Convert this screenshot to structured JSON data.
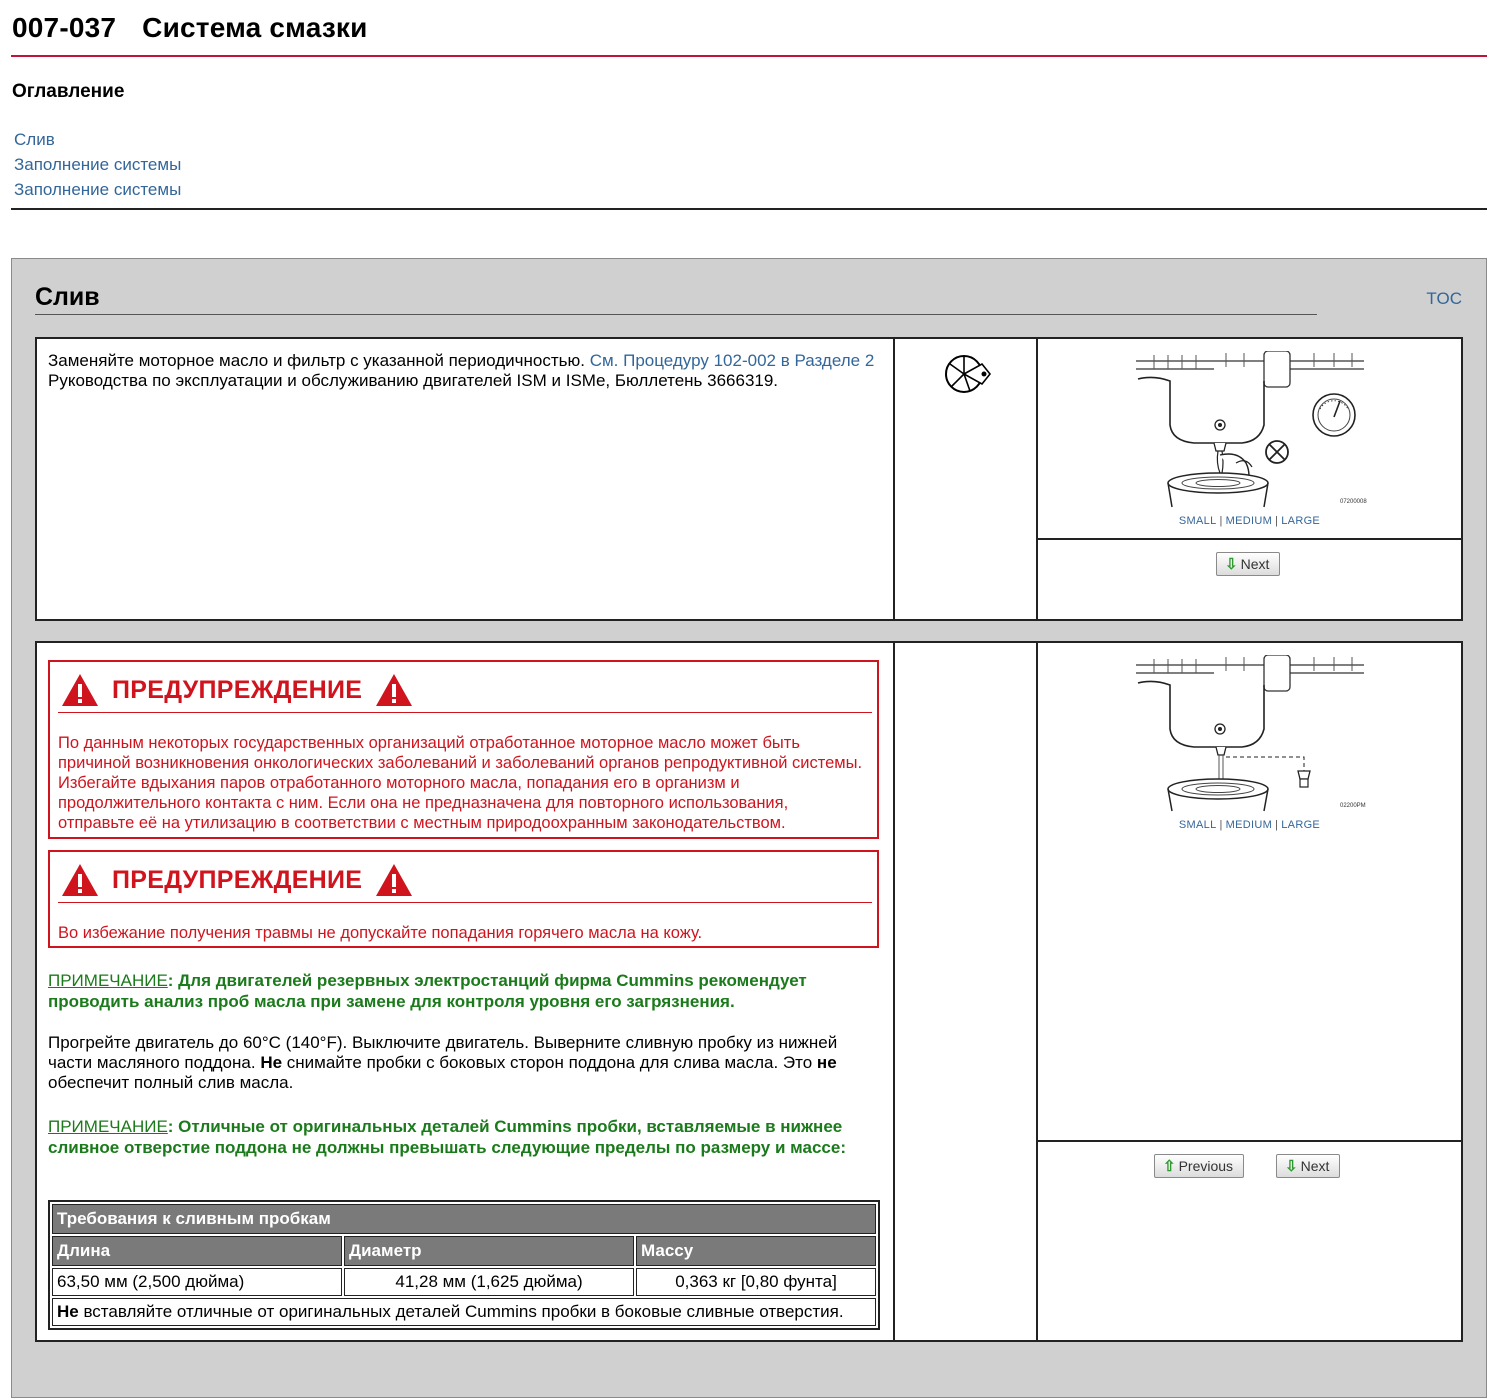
{
  "header": {
    "code": "007-037",
    "title": "Система смазки"
  },
  "toc": {
    "heading": "Оглавление",
    "items": [
      "Слив",
      "Заполнение системы",
      "Заполнение системы"
    ]
  },
  "section": {
    "title": "Слив",
    "toc_link": "TOC"
  },
  "step1": {
    "text_before": "Заменяйте моторное масло и фильтр с указанной периодичностью. ",
    "link": "См. Процедуру 102-002 в Разделе 2",
    "text_after": " Руководства по эксплуатации и обслуживанию двигателей ISM и ISMe, Бюллетень 3666319.",
    "figure_code": "07200008",
    "size_links": {
      "small": "SMALL",
      "medium": "MEDIUM",
      "large": "LARGE"
    },
    "next_label": "Next"
  },
  "step2": {
    "warning1": {
      "title": "ПРЕДУПРЕЖДЕНИЕ",
      "text": "По данным некоторых государственных организаций отработанное моторное масло может быть причиной возникновения онкологических заболеваний и заболеваний органов репродуктивной системы. Избегайте вдыхания паров отработанного моторного масла, попадания его в организм и продолжительного контакта с ним. Если она не предназначена для повторного использования, отправьте её на утилизацию в соответствии с местным природоохранным законодательством."
    },
    "warning2": {
      "title": "ПРЕДУПРЕЖДЕНИЕ",
      "text": "Во избежание получения травмы не допускайте попадания горячего масла на кожу."
    },
    "note1": {
      "label": "ПРИМЕЧАНИЕ",
      "text": ": Для двигателей резервных электростанций фирма Cummins рекомендует проводить анализ проб масла при замене для контроля уровня его загрязнения."
    },
    "body": {
      "p1": "Прогрейте двигатель до 60°C (140°F). Выключите двигатель. Выверните сливную пробку из нижней части масляного поддона. ",
      "b1": "Не",
      "p2": " снимайте пробки с боковых сторон поддона для слива масла. Это ",
      "b2": "не",
      "p3": " обеспечит полный слив масла."
    },
    "note2": {
      "label": "ПРИМЕЧАНИЕ",
      "text": ": Отличные от оригинальных деталей Cummins пробки, вставляемые в нижнее сливное отверстие поддона не должны превышать следующие пределы по размеру и массе:"
    },
    "table": {
      "caption": "Требования к сливным пробкам",
      "headers": [
        "Длина",
        "Диаметр",
        "Массу"
      ],
      "row": [
        "63,50 мм (2,500 дюйма)",
        "41,28 мм (1,625 дюйма)",
        "0,363 кг [0,80 фунта]"
      ],
      "footer_bold": "Не",
      "footer_text": " вставляйте отличные от оригинальных деталей Cummins пробки в боковые сливные отверстия."
    },
    "figure_code": "02200PM",
    "size_links": {
      "small": "SMALL",
      "medium": "MEDIUM",
      "large": "LARGE"
    },
    "previous_label": "Previous",
    "next_label": "Next"
  },
  "colors": {
    "warning": "#d0141e",
    "note": "#1b7a1b",
    "link": "#336699",
    "title_rule": "#c0143c"
  }
}
